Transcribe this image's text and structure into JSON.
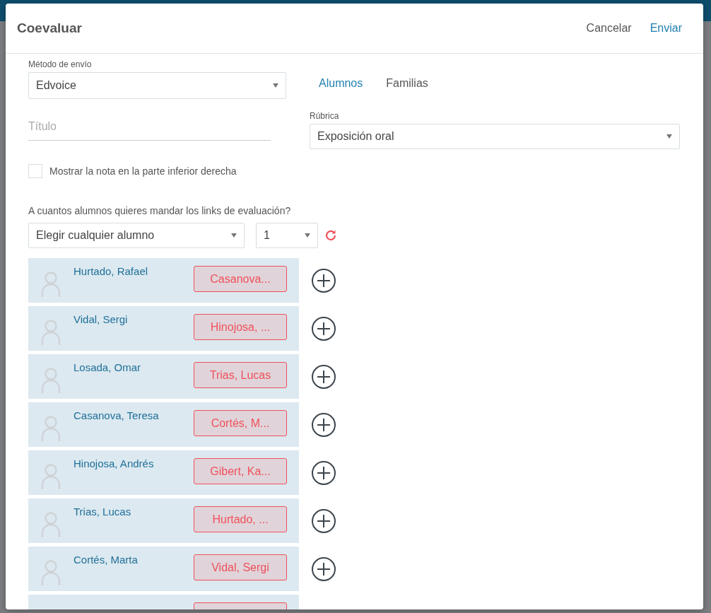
{
  "dialog": {
    "title": "Coevaluar",
    "actions": [
      {
        "label": "Cancelar",
        "kind": "secondary"
      },
      {
        "label": "Enviar",
        "kind": "primary"
      }
    ]
  },
  "send_method": {
    "label": "Método de envío",
    "value": "Edvoice"
  },
  "tabs": [
    {
      "label": "Alumnos",
      "selected": true
    },
    {
      "label": "Familias",
      "selected": false
    }
  ],
  "title_field": {
    "placeholder": "Título"
  },
  "rubric": {
    "label": "Rúbrica",
    "value": "Exposición oral"
  },
  "show_grade": {
    "label": "Mostrar la nota en la parte inferior derecha",
    "checked": false
  },
  "question": "A cuantos alumnos quieres mandar los links de evaluación?",
  "student_picker": {
    "value": "Elegir cualquier alumno"
  },
  "count_picker": {
    "value": "1"
  },
  "students": [
    {
      "name": "Hurtado, Rafael",
      "assigned": "Casanova..."
    },
    {
      "name": "Vidal, Sergi",
      "assigned": "Hinojosa, ..."
    },
    {
      "name": "Losada, Omar",
      "assigned": "Trias, Lucas"
    },
    {
      "name": "Casanova, Teresa",
      "assigned": "Cortés, M..."
    },
    {
      "name": "Hinojosa, Andrés",
      "assigned": "Gibert, Ka..."
    },
    {
      "name": "Trias, Lucas",
      "assigned": "Hurtado, ..."
    },
    {
      "name": "Cortés, Marta",
      "assigned": "Vidal, Sergi"
    }
  ]
}
